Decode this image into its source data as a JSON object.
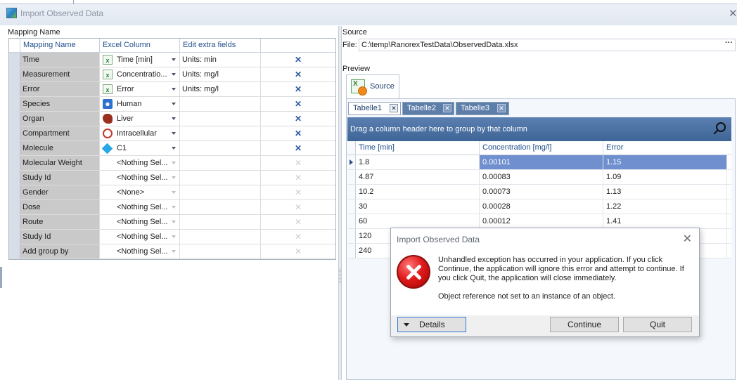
{
  "window": {
    "title": "Import Observed Data",
    "close_glyph": "✕"
  },
  "mapping": {
    "panel_label": "Mapping Name",
    "headers": {
      "name": "Mapping Name",
      "excel": "Excel Column",
      "extra": "Edit extra fields"
    },
    "rows": [
      {
        "name": "Time",
        "excel": "Time [min]",
        "extra": "Units: min",
        "icon": "excel-icon",
        "active": true
      },
      {
        "name": "Measurement",
        "excel": "Concentratio...",
        "extra": "Units: mg/l",
        "icon": "excel-icon",
        "active": true
      },
      {
        "name": "Error",
        "excel": "Error",
        "extra": "Units: mg/l",
        "icon": "excel-icon",
        "active": true
      },
      {
        "name": "Species",
        "excel": "Human",
        "extra": "",
        "icon": "human-icon",
        "active": true
      },
      {
        "name": "Organ",
        "excel": "Liver",
        "extra": "",
        "icon": "liver-icon",
        "active": true
      },
      {
        "name": "Compartment",
        "excel": "Intracellular",
        "extra": "",
        "icon": "cell-icon",
        "active": true
      },
      {
        "name": "Molecule",
        "excel": "C1",
        "extra": "",
        "icon": "molecule-icon",
        "active": true
      },
      {
        "name": "Molecular Weight",
        "excel": "<Nothing Sel...",
        "extra": "",
        "icon": "",
        "active": false
      },
      {
        "name": "Study Id",
        "excel": "<Nothing Sel...",
        "extra": "",
        "icon": "",
        "active": false
      },
      {
        "name": "Gender",
        "excel": "<None>",
        "extra": "",
        "icon": "",
        "active": false
      },
      {
        "name": "Dose",
        "excel": "<Nothing Sel...",
        "extra": "",
        "icon": "",
        "active": false
      },
      {
        "name": "Route",
        "excel": "<Nothing Sel...",
        "extra": "",
        "icon": "",
        "active": false
      },
      {
        "name": "Study Id",
        "excel": "<Nothing Sel...",
        "extra": "",
        "icon": "",
        "active": false
      },
      {
        "name": "Add group by",
        "excel": "<Nothing Sel...",
        "extra": "",
        "icon": "",
        "active": false
      }
    ],
    "delete_glyph": "✕"
  },
  "source": {
    "label": "Source",
    "file_label": "File:",
    "file_path": "C:\\temp\\RanorexTestData\\ObservedData.xlsx",
    "browse_glyph": "···",
    "preview_label": "Preview",
    "source_tab": "Source",
    "sheets": [
      {
        "label": "Tabelle1",
        "active": true
      },
      {
        "label": "Tabelle2",
        "active": false
      },
      {
        "label": "Tabelle3",
        "active": false
      }
    ],
    "sheet_close_glyph": "✕",
    "group_hint": "Drag a column header here to group by that column",
    "columns": [
      "Time [min]",
      "Concentration [mg/l]",
      "Error"
    ],
    "rows": [
      [
        "1.8",
        "0.00101",
        "1.15"
      ],
      [
        "4.87",
        "0.00083",
        "1.09"
      ],
      [
        "10.2",
        "0.00073",
        "1.13"
      ],
      [
        "30",
        "0.00028",
        "1.22"
      ],
      [
        "60",
        "0.00012",
        "1.41"
      ],
      [
        "120",
        "",
        ""
      ],
      [
        "240",
        "",
        ""
      ]
    ]
  },
  "dialog": {
    "title": "Import Observed Data",
    "close_glyph": "✕",
    "message": "Unhandled exception has occurred in your application. If you click Continue, the application will ignore this error and attempt to continue. If you click Quit, the application will close immediately.",
    "detail": "Object reference not set to an instance of an object.",
    "details_label": "Details",
    "continue_label": "Continue",
    "quit_label": "Quit"
  },
  "colors": {
    "accent": "#2c5aa0",
    "group_bar": "#4a6fa5",
    "selection": "#6f8fce",
    "error": "#e11c1c"
  }
}
